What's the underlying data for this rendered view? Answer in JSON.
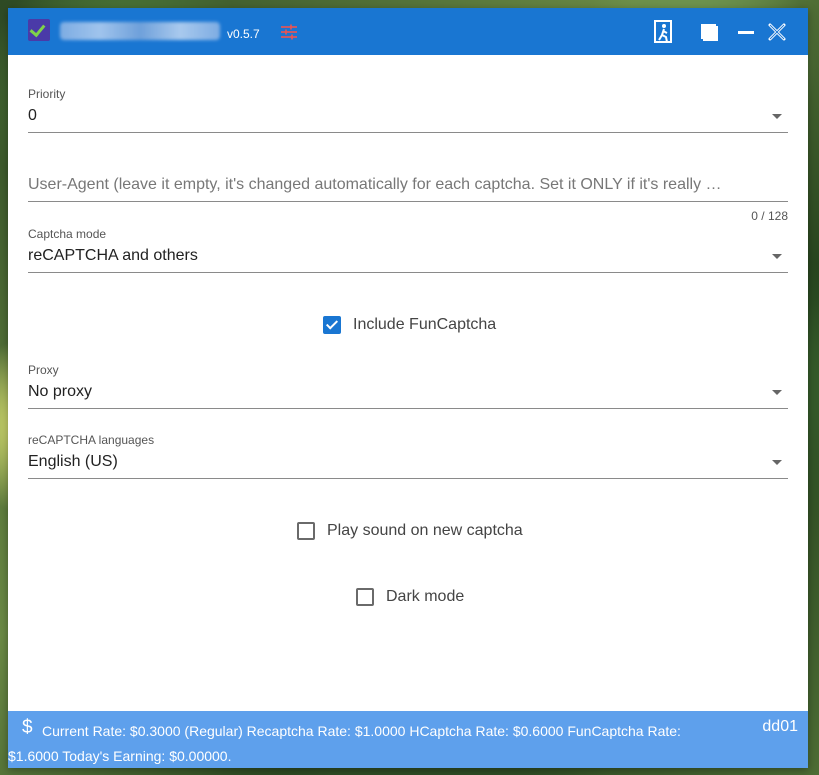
{
  "titlebar": {
    "version": "v0.5.7"
  },
  "priority": {
    "label": "Priority",
    "value": "0"
  },
  "user_agent": {
    "placeholder": "User-Agent (leave it empty, it's changed automatically for each captcha. Set it ONLY if it's really …",
    "counter": "0 / 128"
  },
  "captcha_mode": {
    "label": "Captcha mode",
    "value": "reCAPTCHA and others"
  },
  "include_funcaptcha": {
    "label": "Include FunCaptcha",
    "checked": true
  },
  "proxy": {
    "label": "Proxy",
    "value": "No proxy"
  },
  "recaptcha_languages": {
    "label": "reCAPTCHA languages",
    "value": "English (US)"
  },
  "play_sound": {
    "label": "Play sound on new captcha",
    "checked": false
  },
  "dark_mode": {
    "label": "Dark mode",
    "checked": false
  },
  "footer": {
    "rates": "Current Rate: $0.3000 (Regular) Recaptcha Rate: $1.0000 HCaptcha Rate: $0.6000 FunCaptcha Rate: $1.6000 Today's Earning: $0.00000.",
    "user_id": "dd01"
  },
  "colors": {
    "titlebar": "#1976d2",
    "footer": "#5ea0ec",
    "accent": "#1976d2"
  },
  "icons": {
    "app_logo": "app-logo-icon",
    "tune": "tune-icon",
    "exit": "exit-icon",
    "maximize": "maximize-icon",
    "minimize": "minimize-icon",
    "close": "close-icon",
    "dollar": "dollar-icon",
    "dropdown": "chevron-down-icon"
  }
}
